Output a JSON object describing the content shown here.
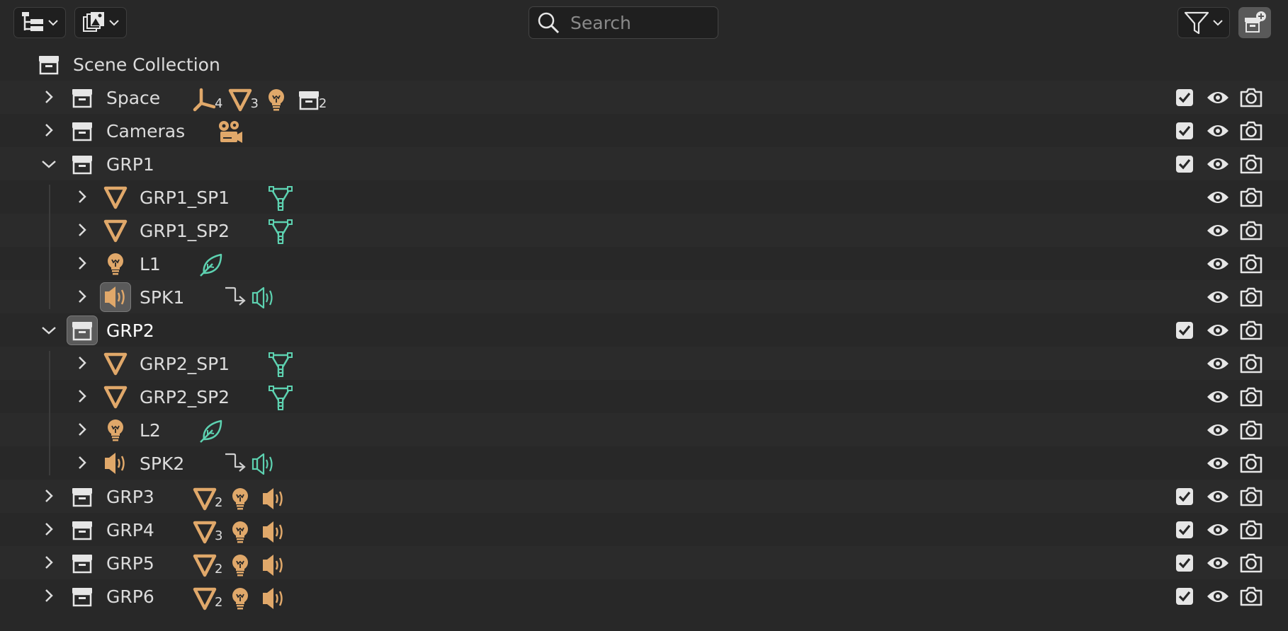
{
  "header": {
    "search_placeholder": "Search"
  },
  "scene_collection": {
    "label": "Scene Collection"
  },
  "rows": [
    {
      "label": "Space",
      "kind": "collection",
      "level": 1,
      "expanded": false,
      "checkbox": true,
      "children": [
        {
          "icon": "empty",
          "count": "4"
        },
        {
          "icon": "mesh",
          "count": "3"
        },
        {
          "icon": "light",
          "count": ""
        },
        {
          "icon": "collection",
          "count": "2"
        }
      ]
    },
    {
      "label": "Cameras",
      "kind": "collection",
      "level": 1,
      "expanded": false,
      "checkbox": true,
      "children": [
        {
          "icon": "camera",
          "count": ""
        }
      ]
    },
    {
      "label": "GRP1",
      "kind": "collection",
      "level": 1,
      "expanded": true,
      "checkbox": true,
      "children": []
    },
    {
      "label": "GRP1_SP1",
      "kind": "mesh",
      "level": 2,
      "expanded": false,
      "checkbox": false,
      "data": [
        "mesh-data"
      ]
    },
    {
      "label": "GRP1_SP2",
      "kind": "mesh",
      "level": 2,
      "expanded": false,
      "checkbox": false,
      "data": [
        "mesh-data"
      ]
    },
    {
      "label": "L1",
      "kind": "light",
      "level": 2,
      "expanded": false,
      "checkbox": false,
      "data": [
        "light-data"
      ]
    },
    {
      "label": "SPK1",
      "kind": "speaker",
      "level": 2,
      "expanded": false,
      "checkbox": false,
      "highlight": true,
      "data": [
        "modifier",
        "speaker-data"
      ]
    },
    {
      "label": "GRP2",
      "kind": "collection",
      "level": 1,
      "expanded": true,
      "checkbox": true,
      "highlight": true,
      "selected": true,
      "children": []
    },
    {
      "label": "GRP2_SP1",
      "kind": "mesh",
      "level": 2,
      "expanded": false,
      "checkbox": false,
      "data": [
        "mesh-data"
      ]
    },
    {
      "label": "GRP2_SP2",
      "kind": "mesh",
      "level": 2,
      "expanded": false,
      "checkbox": false,
      "data": [
        "mesh-data"
      ]
    },
    {
      "label": "L2",
      "kind": "light",
      "level": 2,
      "expanded": false,
      "checkbox": false,
      "data": [
        "light-data"
      ]
    },
    {
      "label": "SPK2",
      "kind": "speaker",
      "level": 2,
      "expanded": false,
      "checkbox": false,
      "data": [
        "modifier",
        "speaker-data"
      ]
    },
    {
      "label": "GRP3",
      "kind": "collection",
      "level": 1,
      "expanded": false,
      "checkbox": true,
      "children": [
        {
          "icon": "mesh",
          "count": "2"
        },
        {
          "icon": "light",
          "count": ""
        },
        {
          "icon": "speaker",
          "count": ""
        }
      ]
    },
    {
      "label": "GRP4",
      "kind": "collection",
      "level": 1,
      "expanded": false,
      "checkbox": true,
      "children": [
        {
          "icon": "mesh",
          "count": "3"
        },
        {
          "icon": "light",
          "count": ""
        },
        {
          "icon": "speaker",
          "count": ""
        }
      ]
    },
    {
      "label": "GRP5",
      "kind": "collection",
      "level": 1,
      "expanded": false,
      "checkbox": true,
      "children": [
        {
          "icon": "mesh",
          "count": "2"
        },
        {
          "icon": "light",
          "count": ""
        },
        {
          "icon": "speaker",
          "count": ""
        }
      ]
    },
    {
      "label": "GRP6",
      "kind": "collection",
      "level": 1,
      "expanded": false,
      "checkbox": true,
      "children": [
        {
          "icon": "mesh",
          "count": "2"
        },
        {
          "icon": "light",
          "count": ""
        },
        {
          "icon": "speaker",
          "count": ""
        }
      ]
    }
  ],
  "colors": {
    "background": "#282828",
    "row_alt": "#2b2b2b",
    "object_orange": "#e0a86a",
    "data_green": "#5dd1b0",
    "text": "#dcdcdc",
    "icon_white": "#e6e6e6"
  }
}
